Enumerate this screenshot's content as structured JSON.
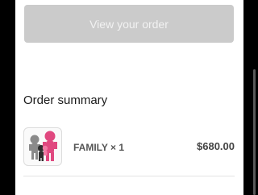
{
  "order_actions": {
    "view_order_label": "View your order"
  },
  "order_summary": {
    "title": "Order summary",
    "items": [
      {
        "name": "FAMILY",
        "quantity_text": "FAMILY × 1",
        "price": "$680.00",
        "thumbnail_icon": "figures-thumbnail-icon"
      }
    ]
  },
  "colors": {
    "button_bg": "#cbcbcb",
    "frame_bg": "#000000",
    "panel_bg": "#ffffff"
  }
}
